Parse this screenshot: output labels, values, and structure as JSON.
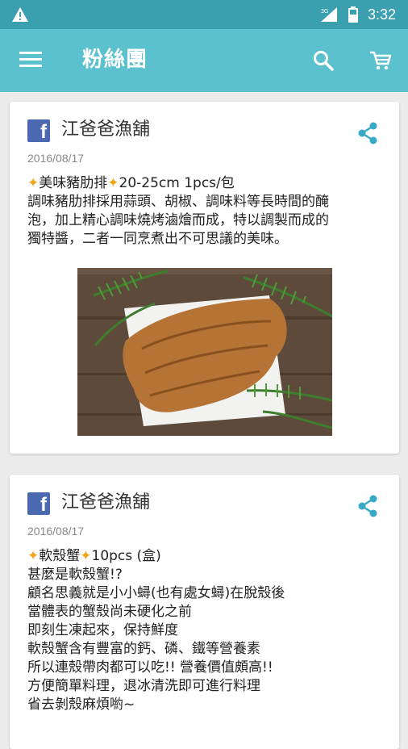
{
  "status_bar": {
    "time": "3:32",
    "network": "3G",
    "warning_icon": "warning-icon",
    "signal_icon": "signal-icon",
    "battery_icon": "battery-icon"
  },
  "app_bar": {
    "title": "粉絲團",
    "menu_icon": "menu-icon",
    "search_icon": "search-icon",
    "cart_icon": "cart-icon",
    "color": "#5bc1cf"
  },
  "posts": [
    {
      "author": "江爸爸漁舖",
      "date": "2016/08/17",
      "headline": "美味豬肋排",
      "headline_suffix": "20-25cm 1pcs/包",
      "lines": [
        "調味豬肋排採用蒜頭、胡椒、調味料等長時間的醃",
        "泡，加上精心調味燒烤滷燴而成，特以調製而成的",
        "獨特醬，二者一同烹煮出不可思議的美味。"
      ],
      "image": "grilled pork ribs on white plate with fern leaves"
    },
    {
      "author": "江爸爸漁舖",
      "date": "2016/08/17",
      "headline": "軟殼蟹",
      "headline_suffix": "10pcs (盒)",
      "lines": [
        "甚麼是軟殼蟹!?",
        "顧名思義就是小小蟳(也有處女蟳)在脫殼後",
        "當體表的蟹殼尚未硬化之前",
        "即刻生凍起來，保持鮮度",
        "軟殼蟹含有豐富的鈣、磷、鐵等營養素",
        "所以連殼帶肉都可以吃!! 營養價值頗高!!",
        "方便簡單料理，退冰清洗即可進行料理",
        "省去剝殼麻煩喲~"
      ]
    }
  ],
  "colors": {
    "status_bar": "#3a9fae",
    "facebook": "#4a69b0",
    "share": "#3aa9c8",
    "sparkle": "#f2a41c"
  }
}
